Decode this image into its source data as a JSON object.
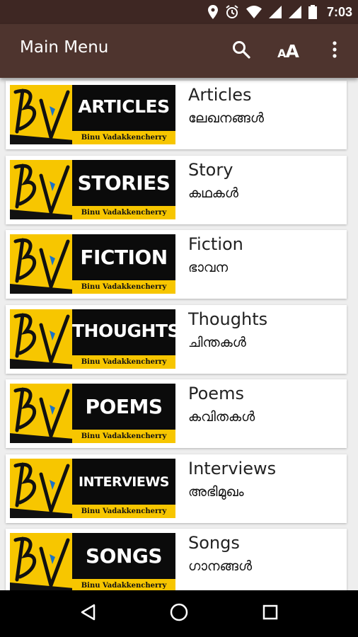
{
  "status_bar": {
    "time": "7:03",
    "icons": [
      "location-icon",
      "alarm-icon",
      "wifi-icon",
      "signal-icon",
      "battery-icon"
    ]
  },
  "app_bar": {
    "title": "Main Menu",
    "actions": [
      "search-icon",
      "font-size-icon",
      "overflow-menu-icon"
    ],
    "font_size_label_small": "A",
    "font_size_label_big": "A"
  },
  "menu_items": [
    {
      "title": "Articles",
      "subtitle": "ലേഖനങ്ങൾ",
      "banner": "ARTICLES",
      "byline": "Binu Vadakkencherry"
    },
    {
      "title": "Story",
      "subtitle": "കഥകൾ",
      "banner": "STORIES",
      "byline": "Binu Vadakkencherry"
    },
    {
      "title": "Fiction",
      "subtitle": "ഭാവന",
      "banner": "FICTION",
      "byline": "Binu Vadakkencherry"
    },
    {
      "title": "Thoughts",
      "subtitle": "ചിന്തകൾ",
      "banner": "THOUGHTS",
      "byline": "Binu Vadakkencherry"
    },
    {
      "title": "Poems",
      "subtitle": "കവിതകൾ",
      "banner": "POEMS",
      "byline": "Binu Vadakkencherry"
    },
    {
      "title": "Interviews",
      "subtitle": "അഭിമുഖം",
      "banner": "INTERVIEWS",
      "byline": "Binu Vadakkencherry"
    },
    {
      "title": "Songs",
      "subtitle": "ഗാനങ്ങൾ",
      "banner": "SONGS",
      "byline": "Binu Vadakkencherry"
    }
  ],
  "logo_text": "BV",
  "nav_bar": [
    "back-icon",
    "home-icon",
    "recents-icon"
  ],
  "colors": {
    "status_bar": "#3e2723",
    "app_bar": "#4e342e",
    "logo_yellow": "#f7c600",
    "banner_black": "#0b0b0b"
  }
}
